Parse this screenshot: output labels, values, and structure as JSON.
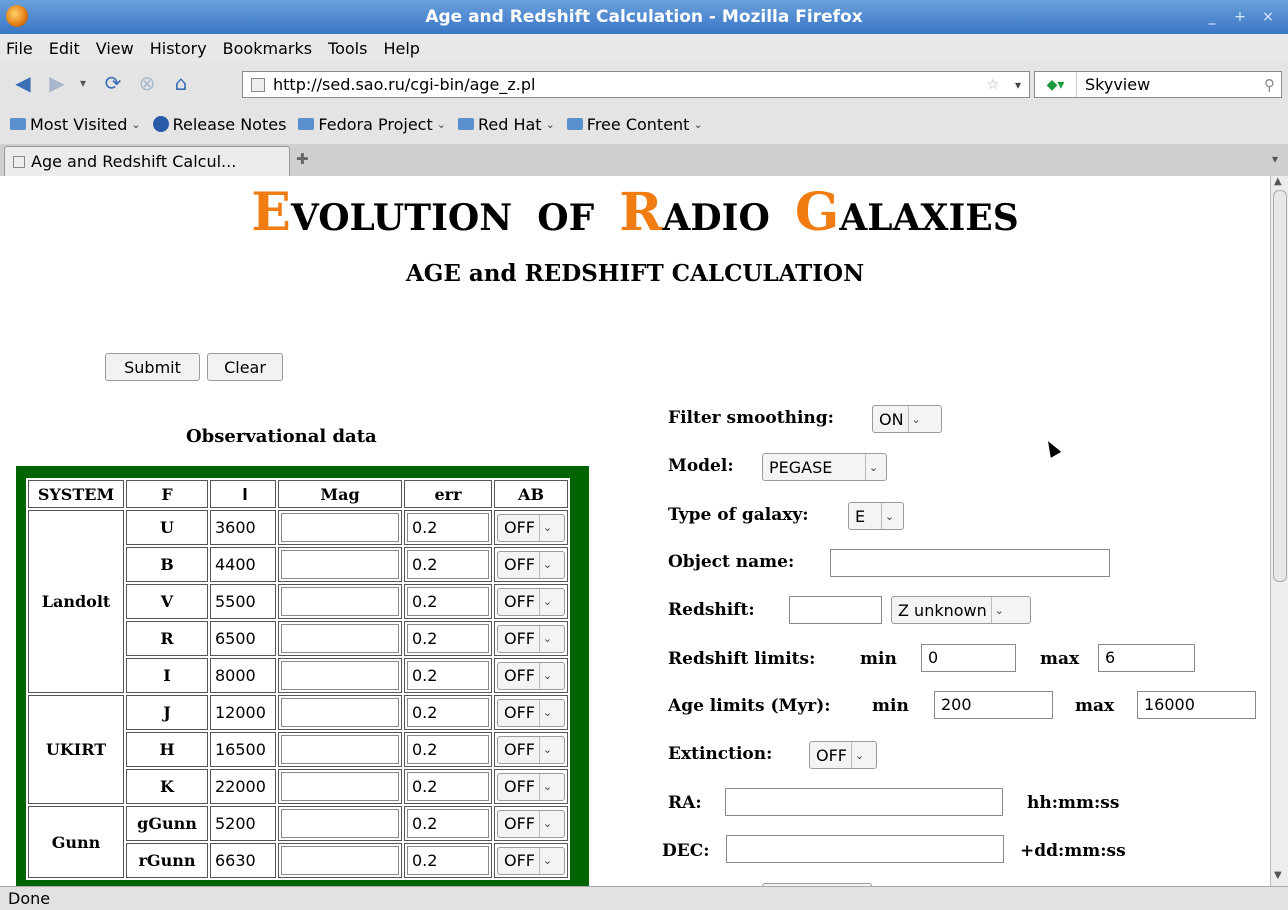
{
  "window": {
    "title": "Age and Redshift Calculation - Mozilla Firefox",
    "controls": [
      "_",
      "+",
      "×"
    ]
  },
  "menubar": [
    "File",
    "Edit",
    "View",
    "History",
    "Bookmarks",
    "Tools",
    "Help"
  ],
  "navigation": {
    "url": "http://sed.sao.ru/cgi-bin/age_z.pl",
    "search_engine_text": "Skyview"
  },
  "bookmarks": [
    {
      "label": "Most Visited",
      "icon": "folder-icon",
      "dropdown": true
    },
    {
      "label": "Release Notes",
      "icon": "fedora-icon",
      "dropdown": false
    },
    {
      "label": "Fedora Project",
      "icon": "folder-icon",
      "dropdown": true
    },
    {
      "label": "Red Hat",
      "icon": "folder-icon",
      "dropdown": true
    },
    {
      "label": "Free Content",
      "icon": "folder-icon",
      "dropdown": true
    }
  ],
  "tab": {
    "label": "Age and Redshift Calcul..."
  },
  "status": "Done",
  "page": {
    "title_parts": {
      "cap1": "E",
      "rest1": "VOLUTION",
      "of": "OF",
      "cap2": "R",
      "rest2": "ADIO",
      "cap3": "G",
      "rest3": "ALAXIES"
    },
    "accent_color": "#f07c12",
    "subtitle": "AGE and REDSHIFT CALCULATION",
    "submit_label": "Submit",
    "clear_label": "Clear",
    "observational_heading": "Observational data",
    "table_border_color": "#006400",
    "table": {
      "headers": {
        "system": "SYSTEM",
        "f": "F",
        "l": "l",
        "mag": "Mag",
        "err": "err",
        "ab": "AB"
      },
      "groups": [
        {
          "system": "Landolt",
          "rows": [
            {
              "f": "U",
              "l": "3600",
              "mag": "",
              "err": "0.2",
              "ab": "OFF"
            },
            {
              "f": "B",
              "l": "4400",
              "mag": "",
              "err": "0.2",
              "ab": "OFF"
            },
            {
              "f": "V",
              "l": "5500",
              "mag": "",
              "err": "0.2",
              "ab": "OFF"
            },
            {
              "f": "R",
              "l": "6500",
              "mag": "",
              "err": "0.2",
              "ab": "OFF"
            },
            {
              "f": "I",
              "l": "8000",
              "mag": "",
              "err": "0.2",
              "ab": "OFF"
            }
          ]
        },
        {
          "system": "UKIRT",
          "rows": [
            {
              "f": "J",
              "l": "12000",
              "mag": "",
              "err": "0.2",
              "ab": "OFF"
            },
            {
              "f": "H",
              "l": "16500",
              "mag": "",
              "err": "0.2",
              "ab": "OFF"
            },
            {
              "f": "K",
              "l": "22000",
              "mag": "",
              "err": "0.2",
              "ab": "OFF"
            }
          ]
        },
        {
          "system": "Gunn",
          "rows": [
            {
              "f": "gGunn",
              "l": "5200",
              "mag": "",
              "err": "0.2",
              "ab": "OFF"
            },
            {
              "f": "rGunn",
              "l": "6630",
              "mag": "",
              "err": "0.2",
              "ab": "OFF"
            }
          ]
        }
      ]
    },
    "params": {
      "filter_smoothing": {
        "label": "Filter smoothing:",
        "value": "ON"
      },
      "model": {
        "label": "Model:",
        "value": "PEGASE"
      },
      "galaxy_type": {
        "label": "Type of galaxy:",
        "value": "E"
      },
      "object_name": {
        "label": "Object name:",
        "value": ""
      },
      "redshift": {
        "label": "Redshift:",
        "value": "",
        "mode": "Z unknown"
      },
      "redshift_limits": {
        "label": "Redshift limits:",
        "min_label": "min",
        "min": "0",
        "max_label": "max",
        "max": "6"
      },
      "age_limits": {
        "label": "Age limits (Myr):",
        "min_label": "min",
        "min": "200",
        "max_label": "max",
        "max": "16000"
      },
      "extinction": {
        "label": "Extinction:",
        "value": "OFF"
      },
      "ra": {
        "label": "RA:",
        "value": "",
        "unit": "hh:mm:ss"
      },
      "dec": {
        "label": "DEC:",
        "value": "",
        "unit": "+dd:mm:ss"
      }
    }
  }
}
